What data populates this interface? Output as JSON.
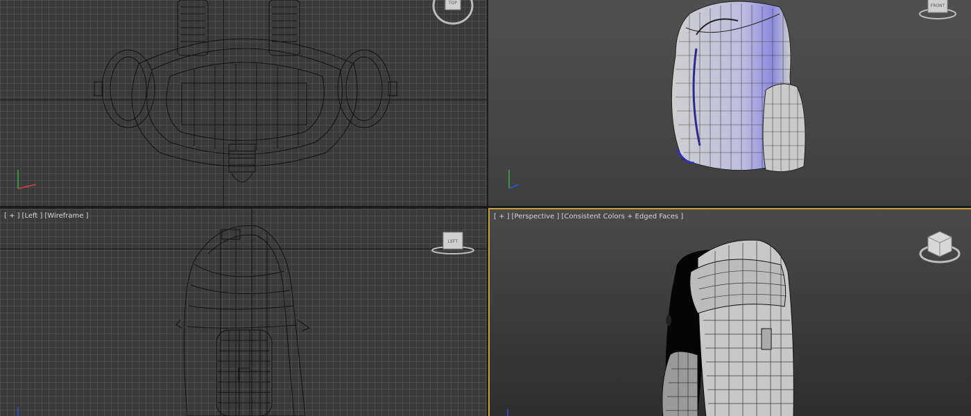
{
  "viewports": {
    "top": {
      "view_label": ""
    },
    "front": {
      "view_label": ""
    },
    "left": {
      "plus": "[ + ]",
      "view": "[Left ]",
      "shading": "[Wireframe ]",
      "cube_label": "LEFT"
    },
    "perspective": {
      "plus": "[ + ]",
      "view": "[Perspective ]",
      "shading": "[Consistent Colors + Edged Faces ]"
    }
  },
  "viewcubes": {
    "top": "TOP",
    "front": "FRONT",
    "left": "LEFT"
  },
  "colors": {
    "active_border": "#c9a23a",
    "grid_line": "#4b4b4b",
    "wire": "#111111",
    "selection_blue": "#7a7ad8"
  }
}
